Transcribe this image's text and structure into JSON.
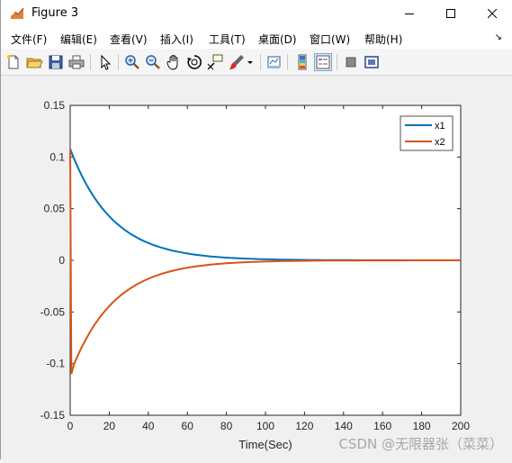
{
  "window": {
    "title": "Figure 3",
    "controls": [
      "minimize-icon",
      "maximize-icon",
      "close-icon"
    ]
  },
  "menu": {
    "items": [
      "文件(F)",
      "编辑(E)",
      "查看(V)",
      "插入(I)",
      "工具(T)",
      "桌面(D)",
      "窗口(W)",
      "帮助(H)"
    ]
  },
  "toolbar": {
    "icons": [
      "new-figure-icon",
      "open-file-icon",
      "save-icon",
      "print-icon",
      "edit-plot-arrow-icon",
      "zoom-in-icon",
      "zoom-out-icon",
      "pan-hand-icon",
      "rotate-3d-icon",
      "data-cursor-icon",
      "brush-icon",
      "brush-dropdown-icon",
      "link-plot-icon",
      "insert-colorbar-icon",
      "insert-legend-icon",
      "hide-plot-tools-icon",
      "show-plot-tools-icon"
    ]
  },
  "chart_data": {
    "type": "line",
    "xlabel": "Time(Sec)",
    "ylabel": "",
    "title": "",
    "xlim": [
      0,
      200
    ],
    "ylim": [
      -0.15,
      0.15
    ],
    "xticks": [
      "0",
      "20",
      "40",
      "60",
      "80",
      "100",
      "120",
      "140",
      "160",
      "180",
      "200"
    ],
    "yticks": [
      "0.15",
      "0.1",
      "0.05",
      "0",
      "-0.05",
      "-0.1",
      "-0.15"
    ],
    "grid": false,
    "legend_position": "top-right",
    "x": [
      0,
      10,
      20,
      30,
      40,
      50,
      60,
      70,
      80,
      90,
      100,
      110,
      120,
      140,
      160,
      180,
      200
    ],
    "series": [
      {
        "name": "x1",
        "color": "#0072BD",
        "values": [
          0.108,
          0.068,
          0.043,
          0.027,
          0.017,
          0.011,
          0.007,
          0.004,
          0.0027,
          0.0017,
          0.0011,
          0.0007,
          0.0004,
          0.0002,
          0.0001,
          0.0,
          0.0
        ]
      },
      {
        "name": "x2",
        "color": "#D95319",
        "values": [
          -0.11,
          -0.071,
          -0.045,
          -0.029,
          -0.018,
          -0.012,
          -0.007,
          -0.0046,
          -0.0029,
          -0.0018,
          -0.0012,
          -0.0007,
          -0.0005,
          -0.0002,
          -0.0001,
          0.0,
          0.0
        ]
      }
    ],
    "initial_spike": {
      "x2_at_t0_plus": 0.108
    }
  },
  "watermark": "CSDN @无限器张（菜菜）"
}
